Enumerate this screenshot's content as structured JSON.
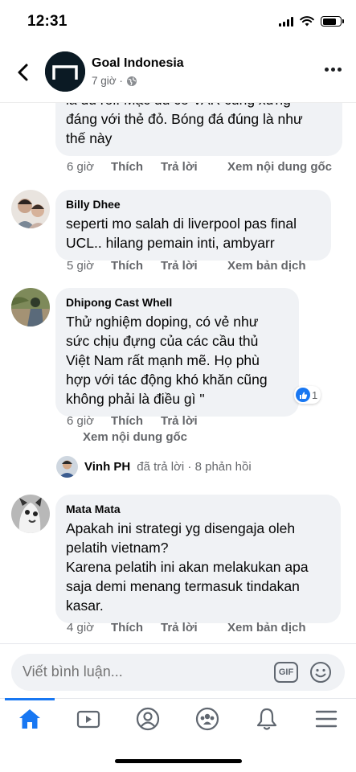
{
  "status_bar": {
    "time": "12:31"
  },
  "header": {
    "page_name": "Goal Indonesia",
    "post_time": "7 giờ ·"
  },
  "comments": [
    {
      "text_lines": [
        "là đủ rồi. Mặc dù có VAR cũng xứng",
        "đáng với thẻ đỏ. Bóng đá đúng là như",
        "thế này"
      ],
      "time": "6 giờ",
      "like_label": "Thích",
      "reply_label": "Trả lời",
      "extra_label": "Xem nội dung gốc"
    },
    {
      "author": "Billy Dhee",
      "text_lines": [
        "seperti mo salah di liverpool pas final",
        "UCL.. hilang pemain inti, ambyarr"
      ],
      "time": "5 giờ",
      "like_label": "Thích",
      "reply_label": "Trả lời",
      "extra_label": "Xem bản dịch"
    },
    {
      "author": "Dhipong Cast Whell",
      "text_lines": [
        "Thử nghiệm doping, có vẻ như",
        "sức chịu đựng của các cầu thủ",
        "Việt Nam rất mạnh mẽ. Họ phù",
        "hợp với tác động khó khăn cũng",
        "không phải là điều gì \""
      ],
      "reaction_count": "1",
      "time": "6 giờ",
      "like_label": "Thích",
      "reply_label": "Trả lời",
      "extra_label": "Xem nội dung gốc"
    },
    {
      "author": "Mata Mata",
      "text_lines": [
        "Apakah ini strategi yg disengaja oleh",
        "pelatih vietnam?",
        "Karena pelatih ini akan melakukan apa",
        "saja demi menang termasuk tindakan",
        "kasar."
      ],
      "time": "4 giờ",
      "like_label": "Thích",
      "reply_label": "Trả lời",
      "extra_label": "Xem bản dịch"
    }
  ],
  "reply_summary": {
    "name": "Vinh PH",
    "rest": "đã trả lời · 8 phản hồi"
  },
  "composer": {
    "placeholder": "Viết bình luận...",
    "gif_label": "GIF"
  },
  "colors": {
    "accent": "#1877f2",
    "bubble": "#f0f2f5",
    "secondary_text": "#65676b"
  },
  "tabs": [
    {
      "icon": "home-icon",
      "active": true
    },
    {
      "icon": "video-icon",
      "active": false
    },
    {
      "icon": "profile-icon",
      "active": false
    },
    {
      "icon": "groups-icon",
      "active": false
    },
    {
      "icon": "bell-icon",
      "active": false
    },
    {
      "icon": "menu-icon",
      "active": false
    }
  ]
}
